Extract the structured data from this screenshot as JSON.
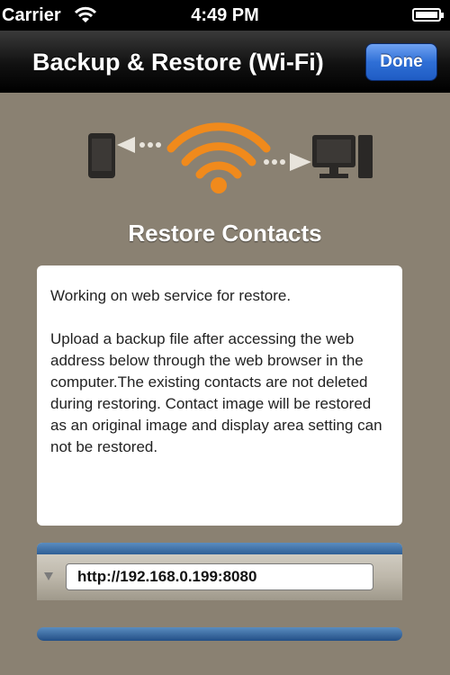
{
  "status_bar": {
    "carrier": "Carrier",
    "time": "4:49 PM"
  },
  "nav": {
    "title": "Backup & Restore (Wi-Fi)",
    "done_label": "Done"
  },
  "section": {
    "title": "Restore Contacts"
  },
  "info": {
    "status": "Working on web service for restore.",
    "body": "Upload a backup file after accessing the web address below through the web browser in the computer.The existing contacts are not deleted during restoring. Contact image will be restored as an original image and display area setting can not be restored."
  },
  "url_panel": {
    "url": "http://192.168.0.199:8080"
  },
  "icons": [
    "phone-icon",
    "wifi-icon",
    "computer-icon",
    "dots-arrow-icon",
    "disclosure-arrow-icon",
    "battery-icon"
  ],
  "colors": {
    "background": "#8a8172",
    "accent_orange": "#f08a1c",
    "done_blue": "#2f6fd6"
  }
}
